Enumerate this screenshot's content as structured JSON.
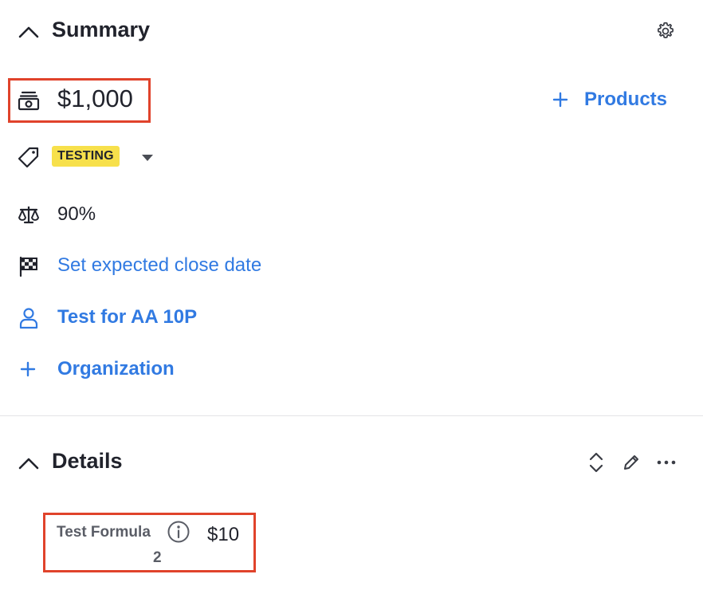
{
  "summary": {
    "title": "Summary",
    "settings_icon": "gear-icon",
    "value": "$1,000",
    "add_products_label": "Products",
    "label_badge": "TESTING",
    "probability": "90%",
    "expected_close_label": "Set expected close date",
    "person_name": "Test for AA 10P",
    "organization_label": "Organization"
  },
  "details": {
    "title": "Details",
    "fields": [
      {
        "label": "Test Formula",
        "label_line2": "2",
        "value": "$10"
      }
    ]
  },
  "colors": {
    "link": "#317ae2",
    "badge_bg": "#f7e04b",
    "highlight_border": "#e0432b"
  }
}
